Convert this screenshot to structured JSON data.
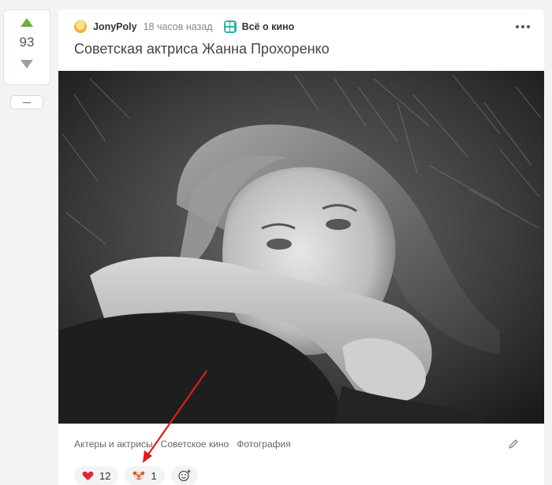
{
  "vote": {
    "count": "93"
  },
  "post": {
    "author": "JonyPoly",
    "time": "18 часов назад",
    "community": "Всё о кино",
    "title": "Советская актриса Жанна Прохоренко"
  },
  "tags": [
    "Актеры и актрисы",
    "Советское кино",
    "Фотография"
  ],
  "reactions": {
    "heart_count": "12",
    "clown_count": "1"
  },
  "colors": {
    "upvote": "#6aae3b",
    "downvote": "#9aa0a6",
    "heart": "#e0262f",
    "annotation": "#e11b1b",
    "community_badge": "#2bb3a6"
  }
}
